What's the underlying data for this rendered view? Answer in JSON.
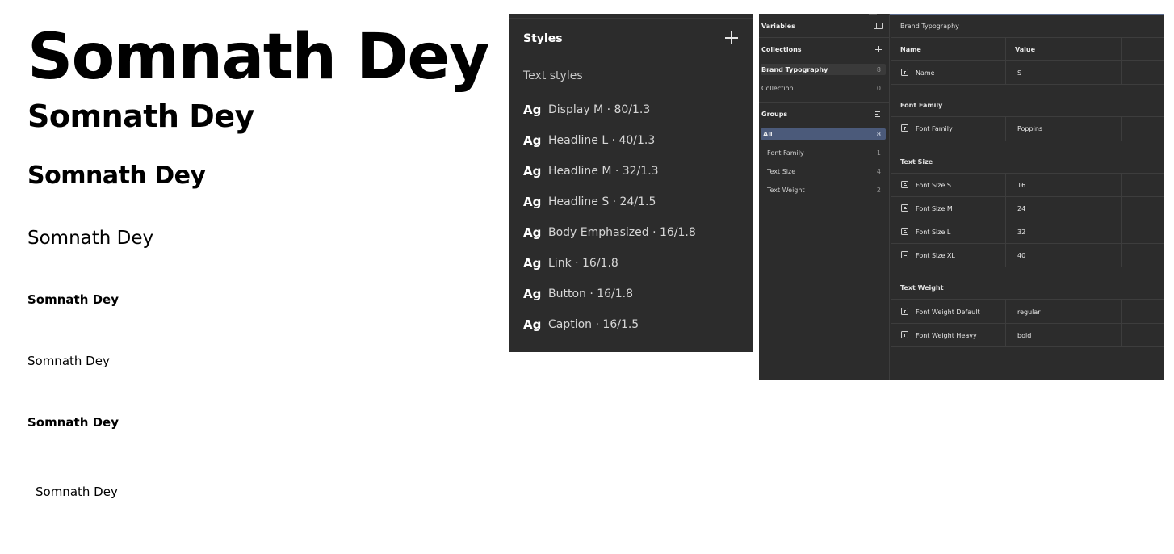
{
  "specimens": {
    "display_m": "Somnath Dey",
    "headline_l": "Somnath Dey",
    "headline_m": "Somnath Dey",
    "headline_s": "Somnath Dey",
    "body_emphasized": "Somnath Dey",
    "link": "Somnath Dey",
    "button": "Somnath Dey",
    "caption": "Somnath Dey"
  },
  "styles_panel": {
    "title": "Styles",
    "add_icon": "plus-icon",
    "section_label": "Text styles",
    "items": [
      {
        "preview": "Ag",
        "label": "Display M · 80/1.3"
      },
      {
        "preview": "Ag",
        "label": "Headline L · 40/1.3"
      },
      {
        "preview": "Ag",
        "label": "Headline M · 32/1.3"
      },
      {
        "preview": "Ag",
        "label": "Headline S · 24/1.5"
      },
      {
        "preview": "Ag",
        "label": "Body Emphasized · 16/1.8"
      },
      {
        "preview": "Ag",
        "label": "Link · 16/1.8"
      },
      {
        "preview": "Ag",
        "label": "Button · 16/1.8"
      },
      {
        "preview": "Ag",
        "label": "Caption · 16/1.5"
      }
    ]
  },
  "variables_panel": {
    "title": "Variables",
    "collections_label": "Collections",
    "collections": [
      {
        "name": "Brand Typography",
        "count": "8",
        "selected": true
      },
      {
        "name": "Collection",
        "count": "0",
        "selected": false
      }
    ],
    "groups_label": "Groups",
    "groups": [
      {
        "name": "All",
        "count": "8",
        "selected": true
      },
      {
        "name": "Font Family",
        "count": "1",
        "selected": false
      },
      {
        "name": "Text Size",
        "count": "4",
        "selected": false
      },
      {
        "name": "Text Weight",
        "count": "2",
        "selected": false
      }
    ],
    "selection_color": "#4b5a7a",
    "collection_selection_color": "#3a3a3a",
    "breadcrumb": "Brand Typography",
    "columns": {
      "name": "Name",
      "value": "Value"
    },
    "rows_top": [
      {
        "type": "text-icon",
        "name": "Name",
        "value": "S"
      }
    ],
    "group_font_family": {
      "label": "Font Family",
      "rows": [
        {
          "type": "text-icon",
          "name": "Font Family",
          "value": "Poppins"
        }
      ]
    },
    "group_text_size": {
      "label": "Text Size",
      "rows": [
        {
          "type": "number-icon",
          "name": "Font Size S",
          "value": "16"
        },
        {
          "type": "number-icon",
          "name": "Font Size M",
          "value": "24"
        },
        {
          "type": "number-icon",
          "name": "Font Size L",
          "value": "32"
        },
        {
          "type": "number-icon",
          "name": "Font Size XL",
          "value": "40"
        }
      ]
    },
    "group_text_weight": {
      "label": "Text Weight",
      "rows": [
        {
          "type": "text-icon",
          "name": "Font Weight Default",
          "value": "regular"
        },
        {
          "type": "text-icon",
          "name": "Font Weight Heavy",
          "value": "bold"
        }
      ]
    }
  }
}
